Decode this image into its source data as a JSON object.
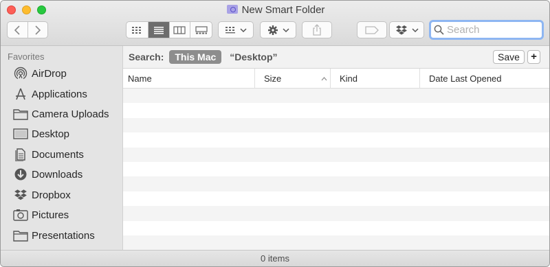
{
  "window": {
    "title": "New Smart Folder"
  },
  "toolbar": {
    "search_placeholder": "Search",
    "view_buttons": [
      "icon-view",
      "list-view",
      "column-view",
      "gallery-view"
    ],
    "active_view": "list-view"
  },
  "sidebar": {
    "heading": "Favorites",
    "items": [
      {
        "label": "AirDrop",
        "icon": "airdrop-icon"
      },
      {
        "label": "Applications",
        "icon": "applications-icon"
      },
      {
        "label": "Camera Uploads",
        "icon": "folder-icon"
      },
      {
        "label": "Desktop",
        "icon": "desktop-icon"
      },
      {
        "label": "Documents",
        "icon": "documents-icon"
      },
      {
        "label": "Downloads",
        "icon": "downloads-icon"
      },
      {
        "label": "Dropbox",
        "icon": "dropbox-icon"
      },
      {
        "label": "Pictures",
        "icon": "pictures-icon"
      },
      {
        "label": "Presentations",
        "icon": "folder-icon"
      }
    ]
  },
  "search_scope": {
    "label": "Search:",
    "this_mac": "This Mac",
    "desktop": "“Desktop”",
    "save_label": "Save",
    "add_label": "+"
  },
  "table": {
    "columns": [
      "Name",
      "Size",
      "Kind",
      "Date Last Opened"
    ],
    "sorted_column": "Size",
    "rows": []
  },
  "status": {
    "text": "0 items"
  }
}
